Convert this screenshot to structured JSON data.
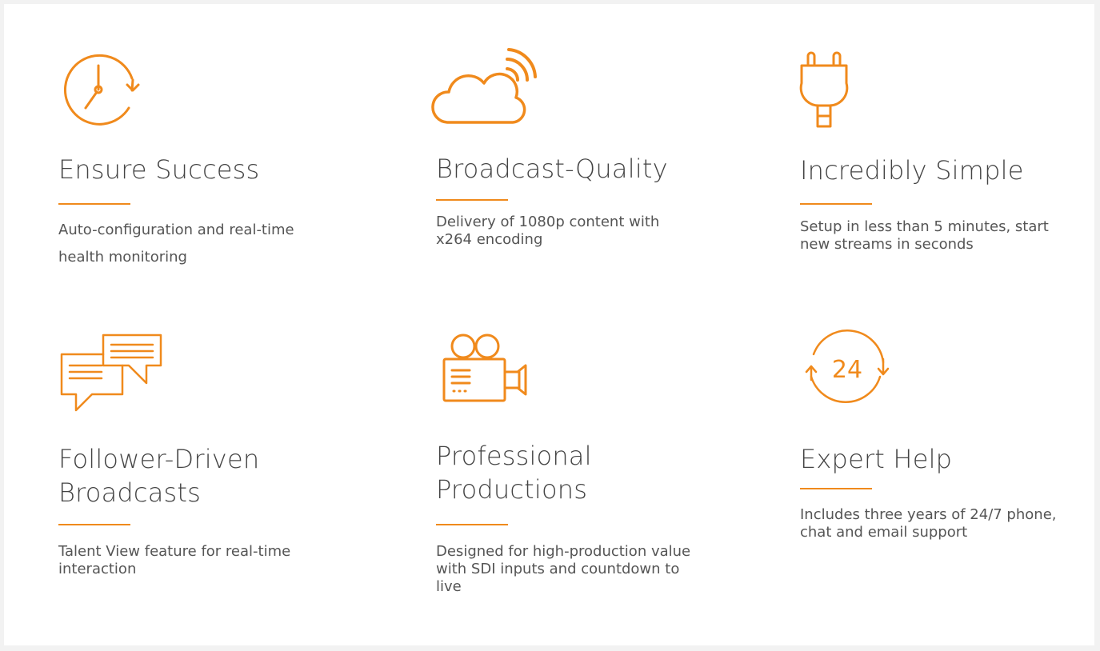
{
  "accent_color": "#f08a1c",
  "features": [
    {
      "icon": "clock-refresh-icon",
      "title": "Ensure Success",
      "description": "Auto-configuration and real-time health monitoring"
    },
    {
      "icon": "cloud-broadcast-icon",
      "title": "Broadcast-Quality",
      "description": "Delivery of 1080p content with x264 encoding"
    },
    {
      "icon": "plug-icon",
      "title": "Incredibly Simple",
      "description": "Setup in less than 5 minutes, start new streams in seconds"
    },
    {
      "icon": "chat-bubbles-icon",
      "title": "Follower-Driven Broadcasts",
      "description": "Talent View feature for real-time interaction"
    },
    {
      "icon": "video-camera-icon",
      "title": "Professional Productions",
      "description": "Designed for high-production value with SDI inputs and countdown to live"
    },
    {
      "icon": "support-24-icon",
      "title": "Expert Help",
      "description": "Includes three years of 24/7 phone, chat and email support",
      "icon_text": "24"
    }
  ]
}
